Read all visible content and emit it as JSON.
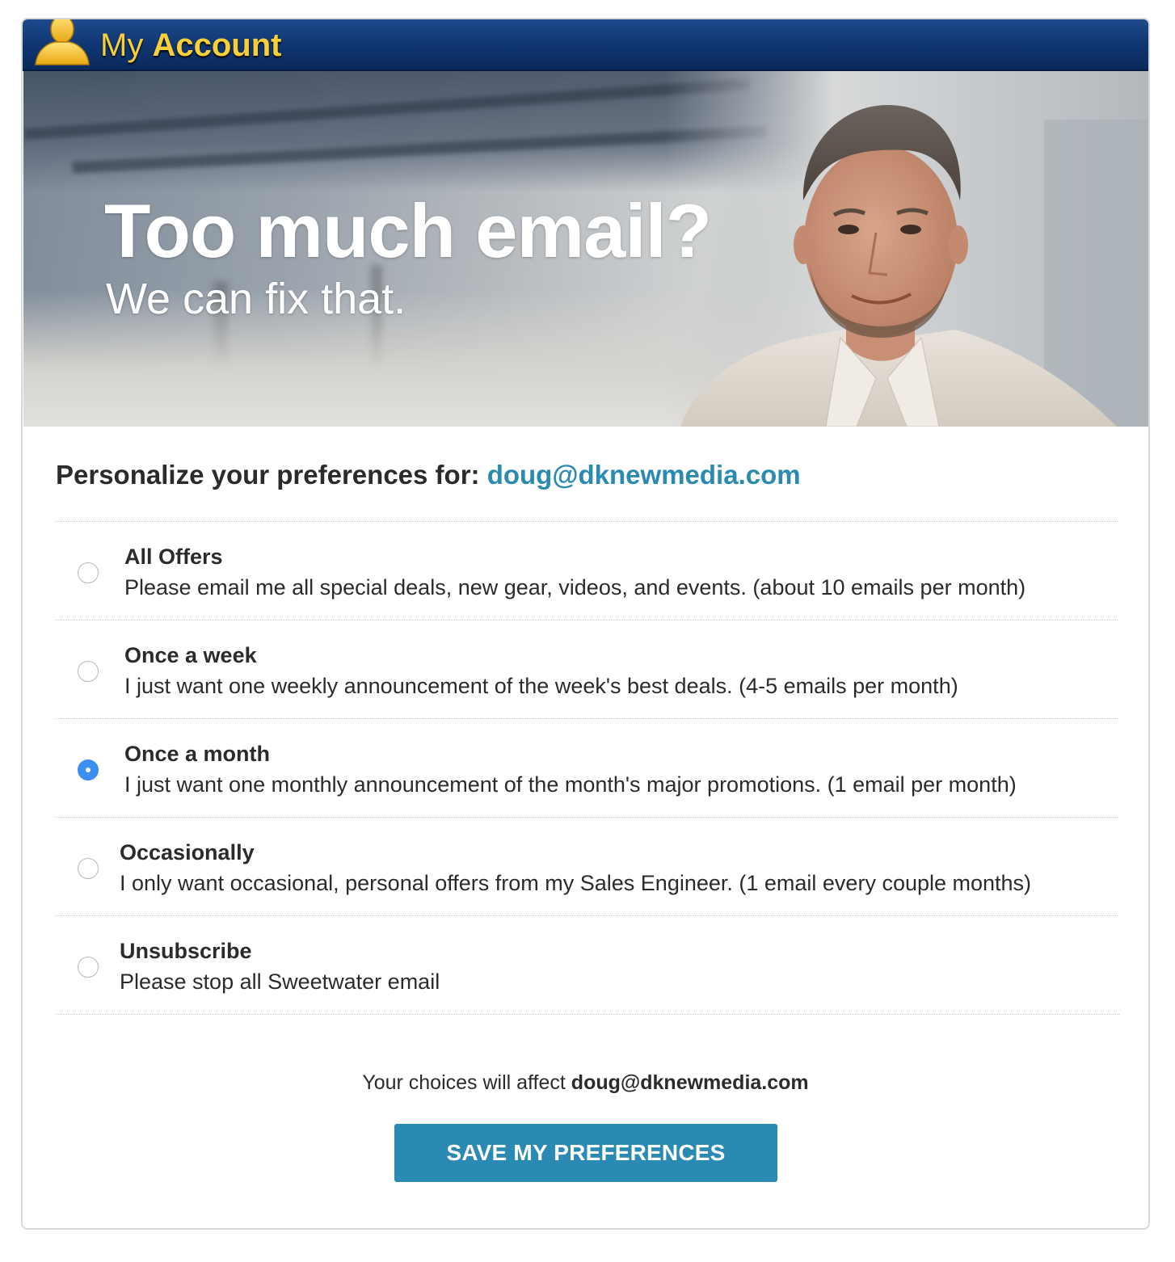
{
  "header": {
    "title_light": "My",
    "title_bold": "Account",
    "icon": "user-silhouette-icon",
    "bar_color": "#0f3570",
    "title_color": "#f6cf3a"
  },
  "hero": {
    "headline": "Too much email?",
    "subheadline": "We can fix that."
  },
  "preferences": {
    "heading": "Personalize your preferences for:",
    "email": "doug@dknewmedia.com",
    "email_color": "#2a8ab0",
    "options": [
      {
        "title": "All Offers",
        "description": "Please email me all special deals, new gear, videos, and events. (about 10 emails per month)",
        "checked": false
      },
      {
        "title": "Once a week",
        "description": "I just want one weekly announcement of the week's best deals. (4-5 emails per month)",
        "checked": false
      },
      {
        "title": "Once a month",
        "description": "I just want one monthly announcement of the month's major promotions. (1 email per month)",
        "checked": true
      },
      {
        "title": "Occasionally",
        "description": "I only want occasional, personal offers from my Sales Engineer. (1 email every couple months)",
        "checked": false
      },
      {
        "title": "Unsubscribe",
        "description": "Please stop all Sweetwater email",
        "checked": false
      }
    ]
  },
  "footer": {
    "affect_text": "Your choices will affect",
    "affect_email": "doug@dknewmedia.com",
    "save_label": "SAVE MY PREFERENCES",
    "button_color": "#2b8ab3",
    "radio_checked_color": "#3b8ff0"
  }
}
